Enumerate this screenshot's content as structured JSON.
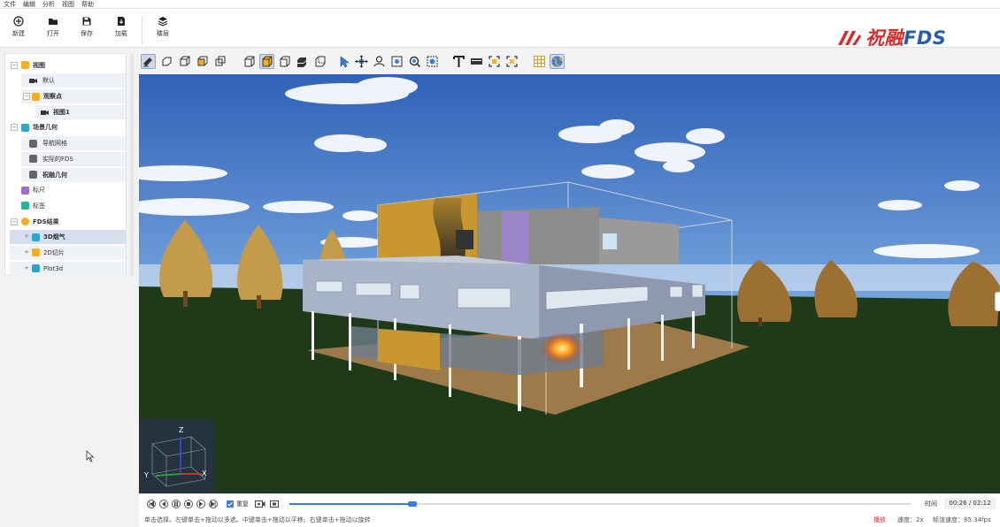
{
  "menu": [
    "文件",
    "编辑",
    "分析",
    "视图",
    "帮助"
  ],
  "ribbon": {
    "new": "新建",
    "open": "打开",
    "save": "保存",
    "load": "加载",
    "layers": "楼层"
  },
  "logo": {
    "prefix": "祝融",
    "suffix": "FDS",
    "brand_color": "#2b5cae",
    "accent_color": "#d62c2c"
  },
  "tree": {
    "views": "视图",
    "default": "默认",
    "viewpoints": "观察点",
    "view1": "视图1",
    "scene_geometry": "场景几何",
    "nav_mesh": "导航网格",
    "fds_object": "实际的FDS",
    "zr_geometry": "祝融几何",
    "ruler": "标尺",
    "label": "标签",
    "fds_results": "FDS结果",
    "smoke3d": "3D烟气",
    "slice2d": "2D切片",
    "plot3d": "Plot3d"
  },
  "toolbar3d_icons": [
    "solid-view-icon",
    "outline-view-icon",
    "wire-box-icon",
    "shaded-box-icon",
    "box-edges-icon",
    "cube-wire-icon",
    "cube-solid-icon",
    "cube-open-icon",
    "cube-stack-icon",
    "cube-iso-icon",
    "select-arrow-icon",
    "pan-icon",
    "orbit-icon",
    "fit-view-icon",
    "zoom-icon",
    "zoom-box-icon",
    "text-icon",
    "bar-icon",
    "frame-select-icon",
    "frame-toggle-icon",
    "grid-icon",
    "globe-icon"
  ],
  "gizmo": {
    "z": "Z",
    "y": "Y",
    "x": "X"
  },
  "playback": {
    "repeat": "重复",
    "progress": 0.198,
    "time_label": "时间",
    "time_value": "00:26 / 02:12"
  },
  "status": {
    "hint": "单击选择。左键单击+拖动以多选。中键单击+拖动以平移。右键单击+拖动以旋转",
    "mode": "播放",
    "speed_label": "速度：",
    "speed_value": "2x",
    "fps_label": "帧渲速度：",
    "fps_value": "85.34fps"
  }
}
